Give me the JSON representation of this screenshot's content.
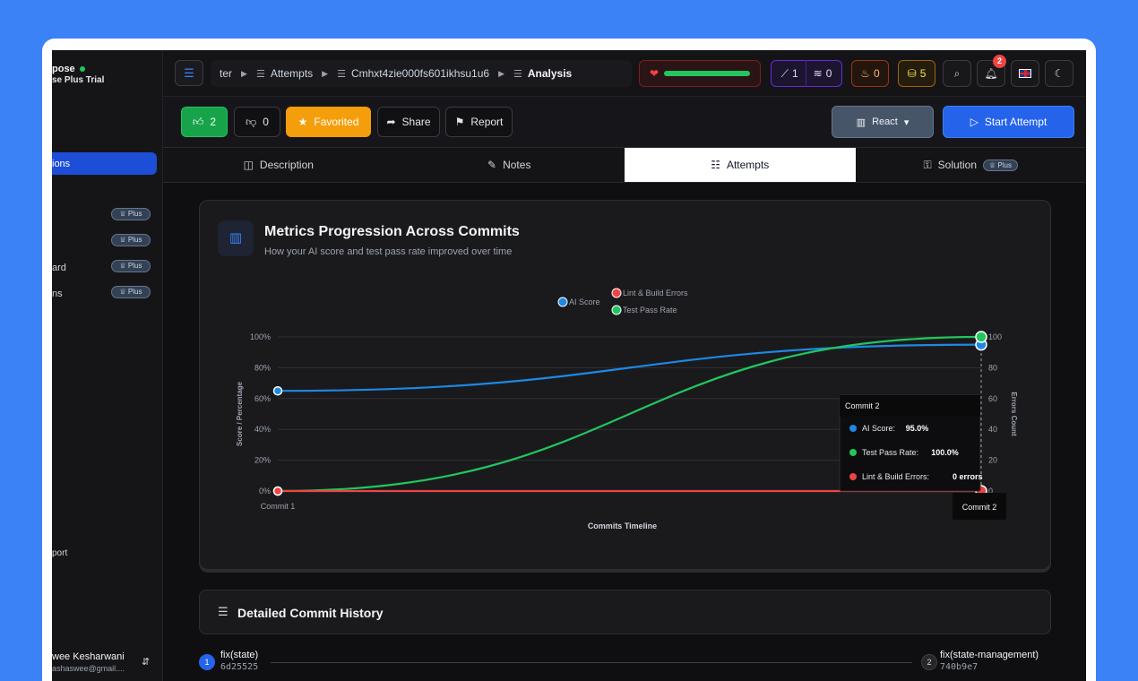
{
  "sidebar": {
    "brand_name": "pose",
    "brand_sub": "se Plus Trial",
    "active_item": "ions",
    "items": [
      {
        "label": "",
        "badge": "Plus"
      },
      {
        "label": "",
        "badge": "Plus"
      },
      {
        "label": "ard",
        "badge": "Plus"
      },
      {
        "label": "ns",
        "badge": "Plus"
      }
    ],
    "support": "port",
    "user_name": "wee Kesharwani",
    "user_email": "ashaswee@gmail....",
    "user_sort_icon": "sort-icon"
  },
  "topbar": {
    "crumbs": [
      "ter",
      "Attempts",
      "Cmhxt4zie000fs601ikhsu1u6",
      "Analysis"
    ],
    "streak_a": "1",
    "streak_b": "0",
    "fire": "0",
    "coins": "5",
    "notifications": "2"
  },
  "actions": {
    "likes": "2",
    "dislikes": "0",
    "favorited": "Favorited",
    "share": "Share",
    "report": "Report",
    "language": "React",
    "start": "Start Attempt"
  },
  "tabs": [
    {
      "label": "Description"
    },
    {
      "label": "Notes"
    },
    {
      "label": "Attempts"
    },
    {
      "label": "Solution",
      "badge": "Plus"
    }
  ],
  "card": {
    "title": "Metrics Progression Across Commits",
    "subtitle": "How your AI score and test pass rate improved over time"
  },
  "chart_data": {
    "type": "line",
    "x": [
      "Commit 1",
      "Commit 2"
    ],
    "xlabel": "Commits Timeline",
    "ylabel": "Score / Percentage",
    "y2label": "Errors Count",
    "ylim": [
      0,
      100
    ],
    "y_ticks": [
      "0%",
      "20%",
      "40%",
      "60%",
      "80%",
      "100%"
    ],
    "y2lim": [
      0,
      100
    ],
    "y2_ticks": [
      "0",
      "20",
      "40",
      "60",
      "80",
      "100"
    ],
    "legend_position": "top-center",
    "series": [
      {
        "name": "AI Score",
        "axis": "left",
        "values": [
          65,
          95
        ],
        "color": "#1e88e5"
      },
      {
        "name": "Test Pass Rate",
        "axis": "left",
        "values": [
          0,
          100
        ],
        "color": "#22c55e"
      },
      {
        "name": "Lint & Build Errors",
        "axis": "right",
        "values": [
          0,
          0
        ],
        "color": "#ef4444"
      }
    ],
    "tooltip": {
      "title": "Commit 2",
      "rows": [
        {
          "label": "AI Score:",
          "value": "95.0%",
          "color": "#1e88e5"
        },
        {
          "label": "Test Pass Rate:",
          "value": "100.0%",
          "color": "#22c55e"
        },
        {
          "label": "Lint & Build Errors:",
          "value": "0 errors",
          "color": "#ef4444"
        }
      ]
    },
    "hover_label": "Commit 2"
  },
  "history": {
    "title": "Detailed Commit History",
    "commits": [
      {
        "num": "1",
        "message": "fix(state)",
        "hash": "6d25525"
      },
      {
        "num": "2",
        "message": "fix(state-management)",
        "hash": "740b9e7"
      }
    ]
  }
}
